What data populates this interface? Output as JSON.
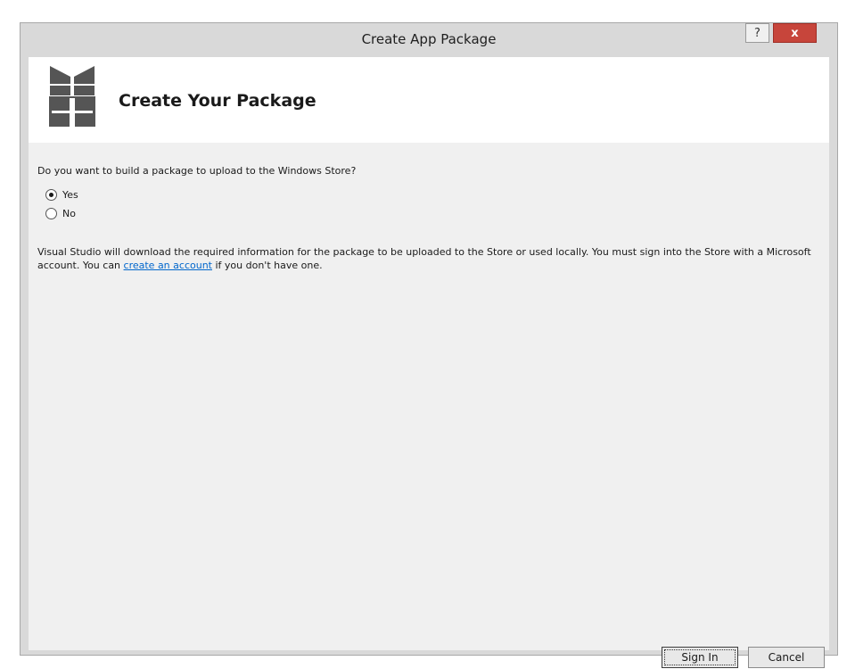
{
  "window": {
    "title": "Create App Package",
    "help_label": "?",
    "close_label": "x"
  },
  "header": {
    "title": "Create Your Package",
    "icon": "gift-icon"
  },
  "form": {
    "question": "Do you want to build a package to upload to the Windows Store?",
    "options": [
      {
        "label": "Yes",
        "selected": true
      },
      {
        "label": "No",
        "selected": false
      }
    ]
  },
  "info": {
    "text_before": "Visual Studio will download the required information for the package to be uploaded to the Store or used locally. You must sign into the Store with a Microsoft account. You can ",
    "link_text": "create an account",
    "text_after": " if you don't have one."
  },
  "buttons": {
    "sign_in": "Sign In",
    "cancel": "Cancel"
  },
  "colors": {
    "link": "#0066cc",
    "close_button": "#c7453b",
    "accent": "#2b7fd0",
    "icon": "#555555"
  }
}
